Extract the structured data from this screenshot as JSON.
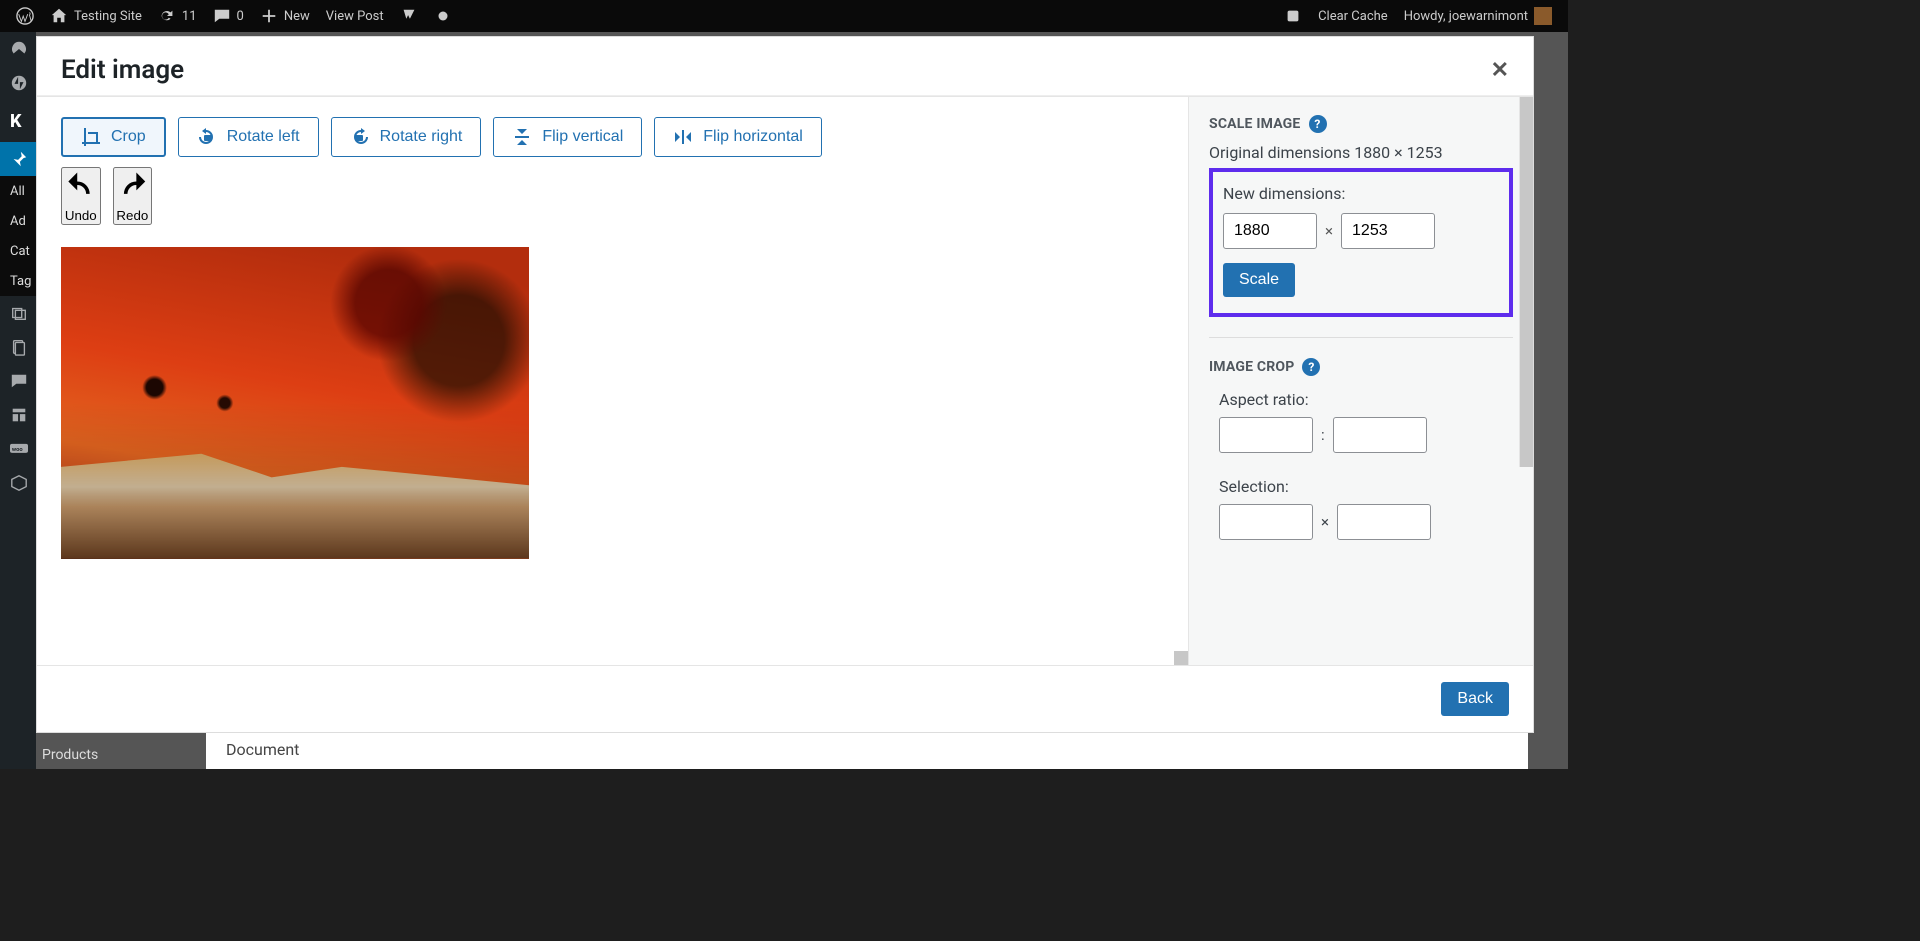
{
  "adminbar": {
    "site_name": "Testing Site",
    "updates_count": "11",
    "comments_count": "0",
    "new_label": "New",
    "view_post": "View Post",
    "clear_cache": "Clear Cache",
    "howdy": "Howdy, joewarnimont"
  },
  "sidebar": {
    "items_labels": {
      "all": "All",
      "add": "Ad",
      "cat": "Cat",
      "tag": "Tag"
    },
    "products_label": "Products"
  },
  "backdrop": {
    "document_label": "Document"
  },
  "modal": {
    "title": "Edit image",
    "close_symbol": "✕",
    "toolbar": {
      "crop": "Crop",
      "rotate_left": "Rotate left",
      "rotate_right": "Rotate right",
      "flip_vertical": "Flip vertical",
      "flip_horizontal": "Flip horizontal",
      "undo": "Undo",
      "redo": "Redo"
    },
    "meta": {
      "scale_heading": "SCALE IMAGE",
      "original_dims_label": "Original dimensions 1880 × 1253",
      "new_dims_label": "New dimensions:",
      "new_width": "1880",
      "new_height": "1253",
      "scale_btn": "Scale",
      "crop_heading": "IMAGE CROP",
      "aspect_label": "Aspect ratio:",
      "selection_label": "Selection:",
      "help_symbol": "?"
    },
    "footer": {
      "back": "Back"
    }
  }
}
